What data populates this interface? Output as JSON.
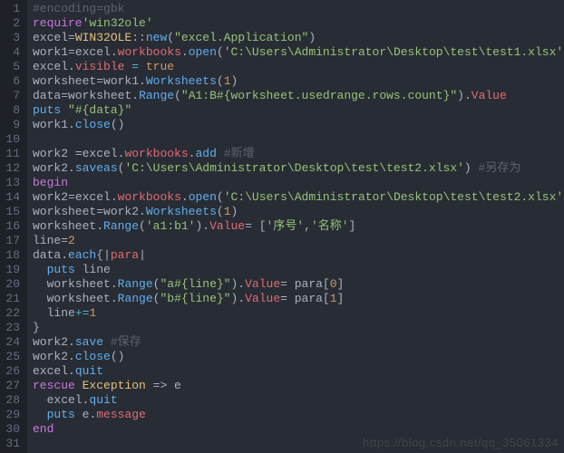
{
  "watermark": "https://blog.csdn.net/qq_35061334",
  "lines": [
    {
      "n": 1,
      "tokens": [
        [
          "cmt",
          "#encoding=gbk"
        ]
      ]
    },
    {
      "n": 2,
      "tokens": [
        [
          "kw",
          "require"
        ],
        [
          "str",
          "'win32ole'"
        ]
      ]
    },
    {
      "n": 3,
      "tokens": [
        [
          "ident",
          "excel"
        ],
        [
          "ident",
          "="
        ],
        [
          "const",
          "WIN32OLE"
        ],
        [
          "ident",
          "::"
        ],
        [
          "fn",
          "new"
        ],
        [
          "ident",
          "("
        ],
        [
          "str",
          "\"excel.Application\""
        ],
        [
          "ident",
          ")"
        ]
      ]
    },
    {
      "n": 4,
      "tokens": [
        [
          "ident",
          "work1"
        ],
        [
          "ident",
          "="
        ],
        [
          "ident",
          "excel"
        ],
        [
          "ident",
          "."
        ],
        [
          "prop",
          "workbooks"
        ],
        [
          "ident",
          "."
        ],
        [
          "fn",
          "open"
        ],
        [
          "ident",
          "("
        ],
        [
          "str",
          "'C:\\Users\\Administrator\\Desktop\\test\\test1.xlsx'"
        ],
        [
          "ident",
          ")"
        ]
      ]
    },
    {
      "n": 5,
      "tokens": [
        [
          "ident",
          "excel"
        ],
        [
          "ident",
          "."
        ],
        [
          "prop",
          "visible"
        ],
        [
          "ident",
          " "
        ],
        [
          "op",
          "="
        ],
        [
          "ident",
          " "
        ],
        [
          "num",
          "true"
        ]
      ]
    },
    {
      "n": 6,
      "tokens": [
        [
          "ident",
          "worksheet"
        ],
        [
          "ident",
          "="
        ],
        [
          "ident",
          "work1"
        ],
        [
          "ident",
          "."
        ],
        [
          "fn",
          "Worksheets"
        ],
        [
          "ident",
          "("
        ],
        [
          "num",
          "1"
        ],
        [
          "ident",
          ")"
        ]
      ]
    },
    {
      "n": 7,
      "tokens": [
        [
          "ident",
          "data"
        ],
        [
          "ident",
          "="
        ],
        [
          "ident",
          "worksheet"
        ],
        [
          "ident",
          "."
        ],
        [
          "fn",
          "Range"
        ],
        [
          "ident",
          "("
        ],
        [
          "str",
          "\"A1:B#{worksheet.usedrange.rows.count}\""
        ],
        [
          "ident",
          ")"
        ],
        [
          "ident",
          "."
        ],
        [
          "prop",
          "Value"
        ]
      ]
    },
    {
      "n": 8,
      "tokens": [
        [
          "fn",
          "puts"
        ],
        [
          "ident",
          " "
        ],
        [
          "str",
          "\"#{data}\""
        ]
      ]
    },
    {
      "n": 9,
      "tokens": [
        [
          "ident",
          "work1"
        ],
        [
          "ident",
          "."
        ],
        [
          "fn",
          "close"
        ],
        [
          "ident",
          "()"
        ]
      ]
    },
    {
      "n": 10,
      "tokens": []
    },
    {
      "n": 11,
      "tokens": [
        [
          "ident",
          "work2 "
        ],
        [
          "ident",
          "="
        ],
        [
          "ident",
          "excel"
        ],
        [
          "ident",
          "."
        ],
        [
          "prop",
          "workbooks"
        ],
        [
          "ident",
          "."
        ],
        [
          "fn",
          "add"
        ],
        [
          "ident",
          " "
        ],
        [
          "cmt",
          "#新增"
        ]
      ]
    },
    {
      "n": 12,
      "tokens": [
        [
          "ident",
          "work2"
        ],
        [
          "ident",
          "."
        ],
        [
          "fn",
          "saveas"
        ],
        [
          "ident",
          "("
        ],
        [
          "str",
          "'C:\\Users\\Administrator\\Desktop\\test\\test2.xlsx'"
        ],
        [
          "ident",
          ") "
        ],
        [
          "cmt",
          "#另存为"
        ]
      ]
    },
    {
      "n": 13,
      "tokens": [
        [
          "kw",
          "begin"
        ]
      ]
    },
    {
      "n": 14,
      "tokens": [
        [
          "ident",
          "work2"
        ],
        [
          "ident",
          "="
        ],
        [
          "ident",
          "excel"
        ],
        [
          "ident",
          "."
        ],
        [
          "prop",
          "workbooks"
        ],
        [
          "ident",
          "."
        ],
        [
          "fn",
          "open"
        ],
        [
          "ident",
          "("
        ],
        [
          "str",
          "'C:\\Users\\Administrator\\Desktop\\test\\test2.xlsx'"
        ],
        [
          "ident",
          ")"
        ]
      ]
    },
    {
      "n": 15,
      "tokens": [
        [
          "ident",
          "worksheet"
        ],
        [
          "ident",
          "="
        ],
        [
          "ident",
          "work2"
        ],
        [
          "ident",
          "."
        ],
        [
          "fn",
          "Worksheets"
        ],
        [
          "ident",
          "("
        ],
        [
          "num",
          "1"
        ],
        [
          "ident",
          ")"
        ]
      ]
    },
    {
      "n": 16,
      "tokens": [
        [
          "ident",
          "worksheet"
        ],
        [
          "ident",
          "."
        ],
        [
          "fn",
          "Range"
        ],
        [
          "ident",
          "("
        ],
        [
          "str",
          "'a1:b1'"
        ],
        [
          "ident",
          ")"
        ],
        [
          "ident",
          "."
        ],
        [
          "prop",
          "Value"
        ],
        [
          "ident",
          "= ["
        ],
        [
          "str",
          "'序号'"
        ],
        [
          "ident",
          ","
        ],
        [
          "str",
          "'名称'"
        ],
        [
          "ident",
          "]"
        ]
      ]
    },
    {
      "n": 17,
      "tokens": [
        [
          "ident",
          "line"
        ],
        [
          "ident",
          "="
        ],
        [
          "num",
          "2"
        ]
      ]
    },
    {
      "n": 18,
      "tokens": [
        [
          "ident",
          "data"
        ],
        [
          "ident",
          "."
        ],
        [
          "fn",
          "each"
        ],
        [
          "ident",
          "{"
        ],
        [
          "pipe",
          "|"
        ],
        [
          "param",
          "para"
        ],
        [
          "pipe",
          "|"
        ]
      ]
    },
    {
      "n": 19,
      "tokens": [
        [
          "ident",
          "  "
        ],
        [
          "fn",
          "puts"
        ],
        [
          "ident",
          " line"
        ]
      ]
    },
    {
      "n": 20,
      "tokens": [
        [
          "ident",
          "  worksheet"
        ],
        [
          "ident",
          "."
        ],
        [
          "fn",
          "Range"
        ],
        [
          "ident",
          "("
        ],
        [
          "str",
          "\"a#{line}\""
        ],
        [
          "ident",
          ")"
        ],
        [
          "ident",
          "."
        ],
        [
          "prop",
          "Value"
        ],
        [
          "ident",
          "= para["
        ],
        [
          "num",
          "0"
        ],
        [
          "ident",
          "]"
        ]
      ]
    },
    {
      "n": 21,
      "tokens": [
        [
          "ident",
          "  worksheet"
        ],
        [
          "ident",
          "."
        ],
        [
          "fn",
          "Range"
        ],
        [
          "ident",
          "("
        ],
        [
          "str",
          "\"b#{line}\""
        ],
        [
          "ident",
          ")"
        ],
        [
          "ident",
          "."
        ],
        [
          "prop",
          "Value"
        ],
        [
          "ident",
          "= para["
        ],
        [
          "num",
          "1"
        ],
        [
          "ident",
          "]"
        ]
      ]
    },
    {
      "n": 22,
      "tokens": [
        [
          "ident",
          "  line"
        ],
        [
          "op",
          "+="
        ],
        [
          "num",
          "1"
        ]
      ]
    },
    {
      "n": 23,
      "tokens": [
        [
          "ident",
          "}"
        ]
      ]
    },
    {
      "n": 24,
      "tokens": [
        [
          "ident",
          "work2"
        ],
        [
          "ident",
          "."
        ],
        [
          "fn",
          "save"
        ],
        [
          "ident",
          " "
        ],
        [
          "cmt",
          "#保存"
        ]
      ]
    },
    {
      "n": 25,
      "tokens": [
        [
          "ident",
          "work2"
        ],
        [
          "ident",
          "."
        ],
        [
          "fn",
          "close"
        ],
        [
          "ident",
          "()"
        ]
      ]
    },
    {
      "n": 26,
      "tokens": [
        [
          "ident",
          "excel"
        ],
        [
          "ident",
          "."
        ],
        [
          "fn",
          "quit"
        ]
      ]
    },
    {
      "n": 27,
      "tokens": [
        [
          "kw",
          "rescue"
        ],
        [
          "ident",
          " "
        ],
        [
          "const",
          "Exception"
        ],
        [
          "ident",
          " => e"
        ]
      ]
    },
    {
      "n": 28,
      "tokens": [
        [
          "ident",
          "  excel"
        ],
        [
          "ident",
          "."
        ],
        [
          "fn",
          "quit"
        ]
      ]
    },
    {
      "n": 29,
      "tokens": [
        [
          "ident",
          "  "
        ],
        [
          "fn",
          "puts"
        ],
        [
          "ident",
          " e"
        ],
        [
          "ident",
          "."
        ],
        [
          "prop",
          "message"
        ]
      ]
    },
    {
      "n": 30,
      "tokens": [
        [
          "kw",
          "end"
        ]
      ]
    },
    {
      "n": 31,
      "tokens": []
    }
  ]
}
